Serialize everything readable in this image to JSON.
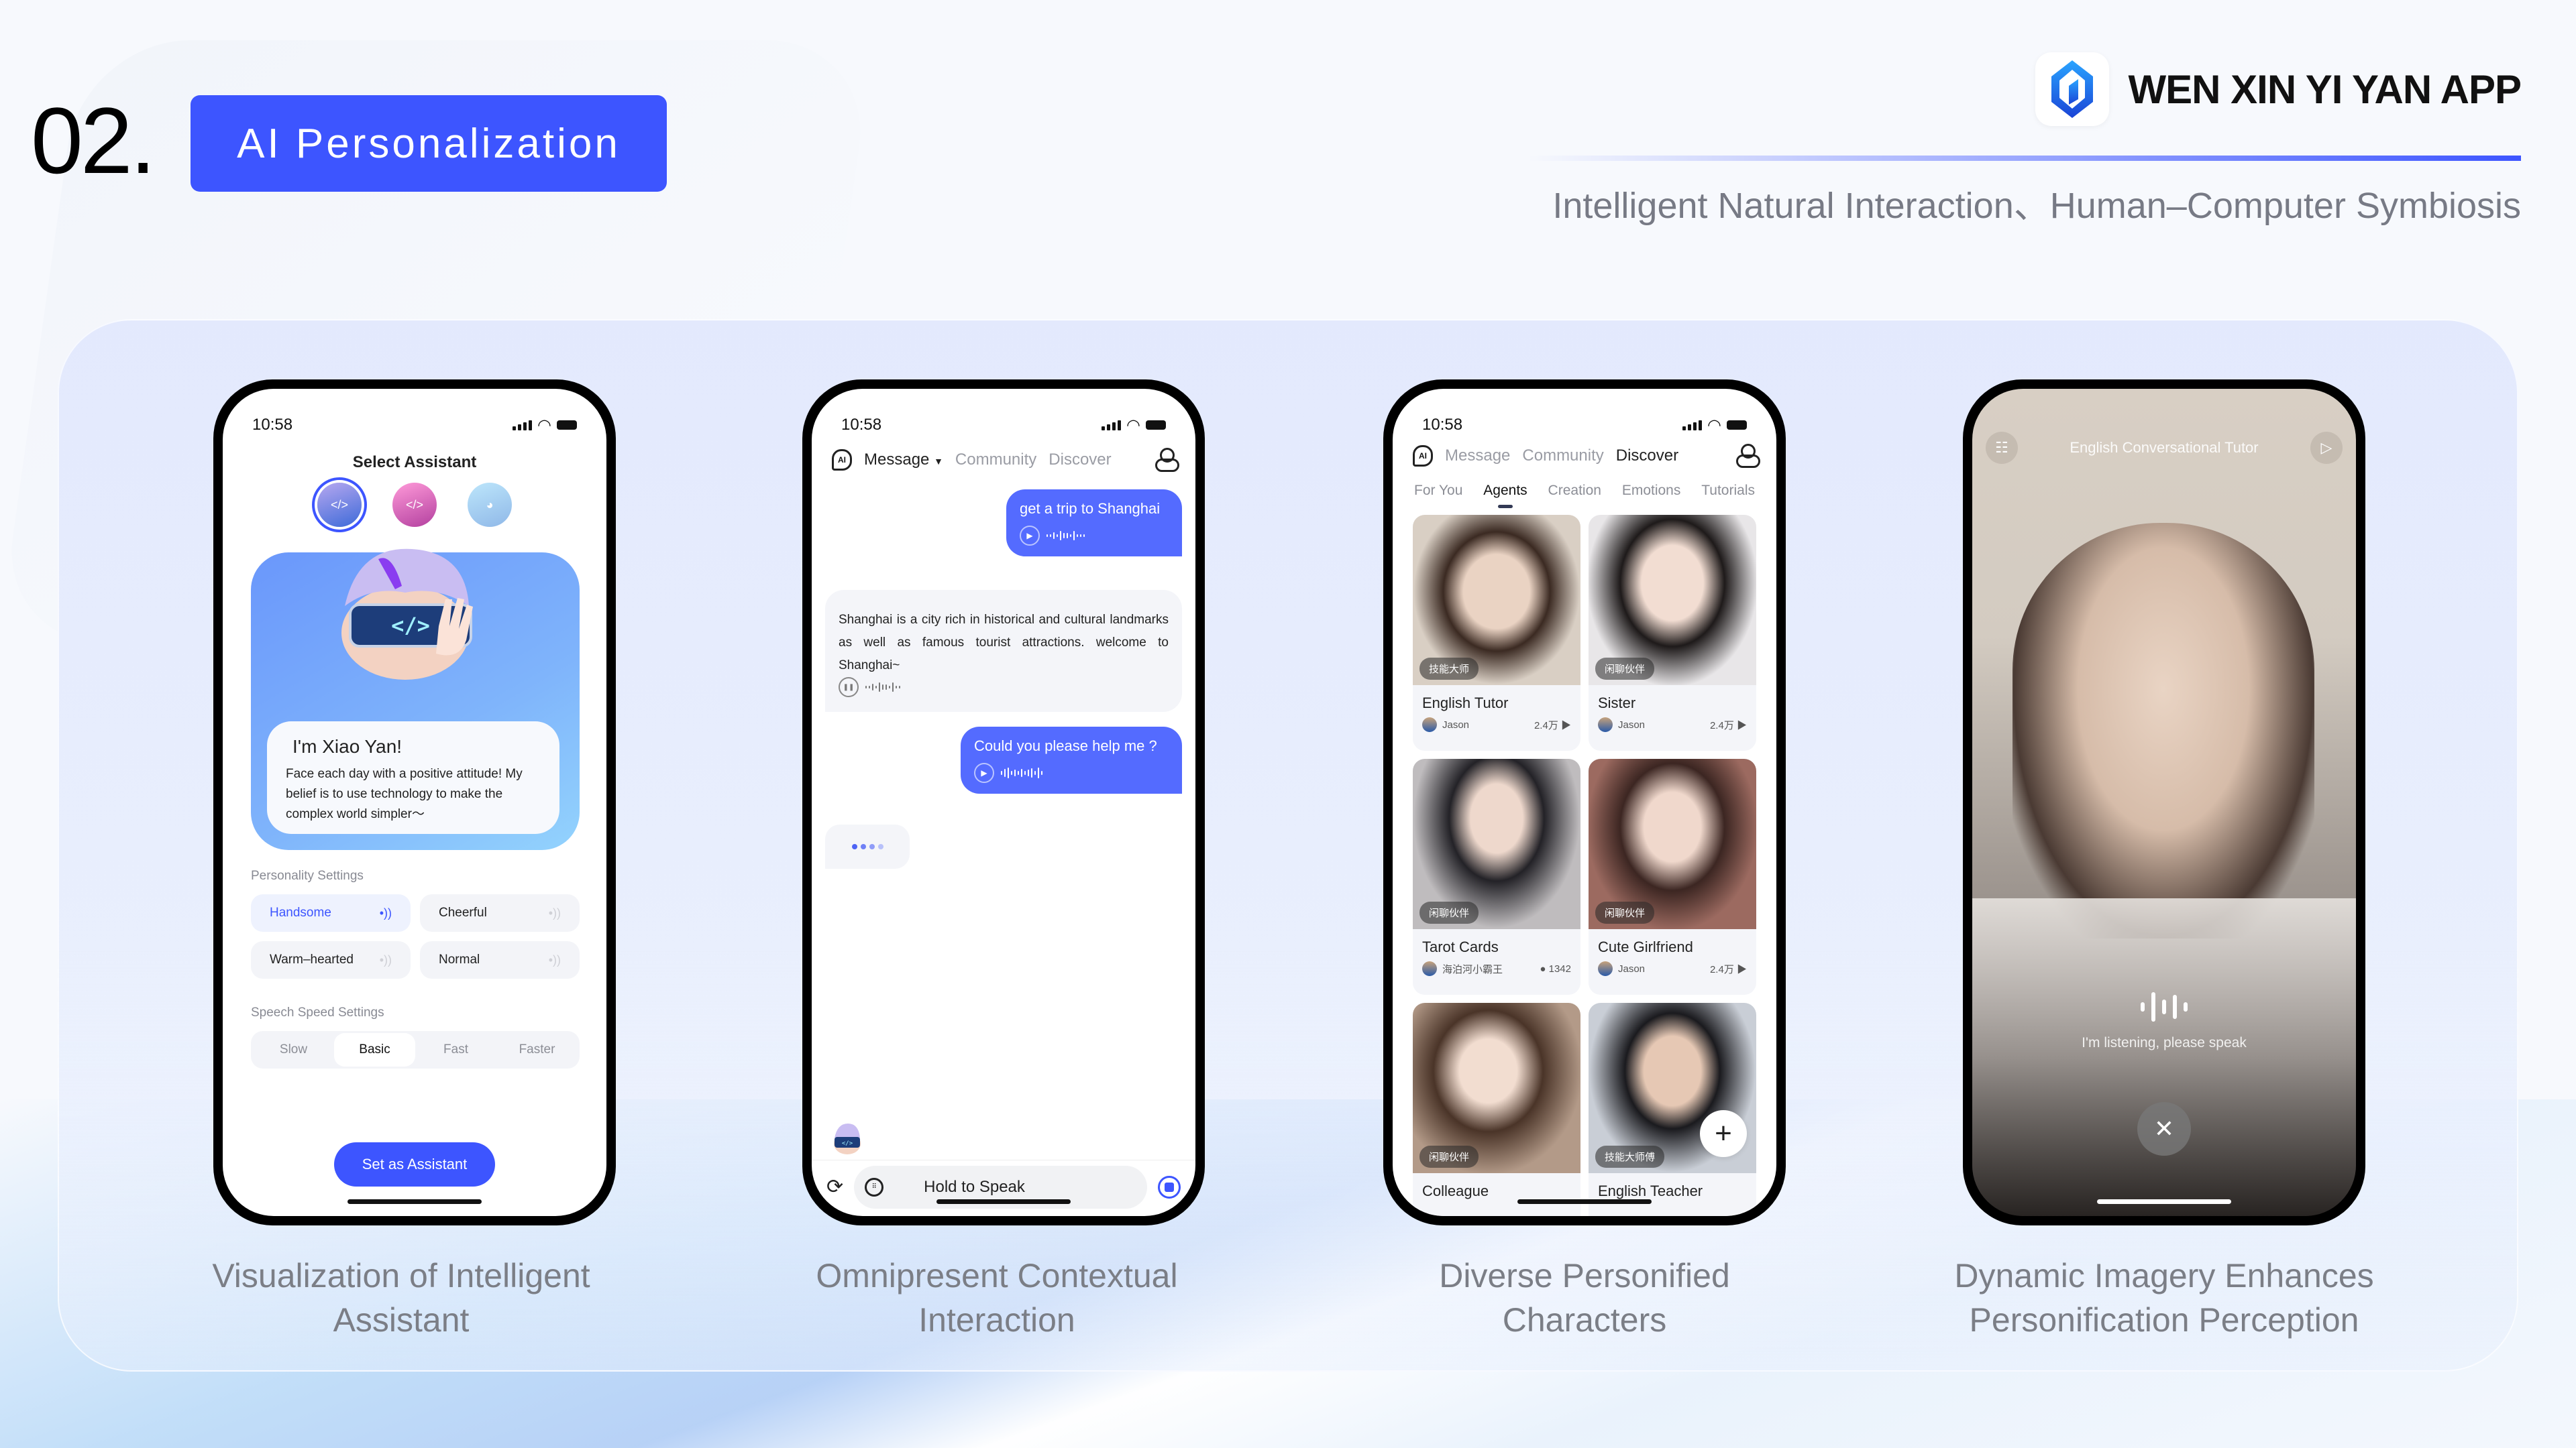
{
  "header": {
    "section_number": "02.",
    "section_title": "AI Personalization",
    "brand_name": "WEN XIN YI YAN APP",
    "tagline": "Intelligent Natural Interaction、Human–Computer Symbiosis",
    "accent_color": "#3d55ff"
  },
  "captions": [
    {
      "line1": "Visualization of Intelligent",
      "line2": "Assistant"
    },
    {
      "line1": "Omnipresent Contextual",
      "line2": "Interaction"
    },
    {
      "line1": "Diverse Personified",
      "line2": "Characters"
    },
    {
      "line1": "Dynamic Imagery Enhances",
      "line2": "Personification Perception"
    }
  ],
  "status_time": "10:58",
  "phone1": {
    "title": "Select Assistant",
    "avatars": [
      "robot-boy-avatar",
      "pink-girl-avatar",
      "anime-boy-avatar"
    ],
    "greeting": "I'm Xiao Yan!",
    "intro": "Face each day with a positive attitude! My belief is to use technology to make the complex world simpler～",
    "personality_label": "Personality Settings",
    "personalities": [
      {
        "label": "Handsome",
        "selected": true
      },
      {
        "label": "Cheerful",
        "selected": false
      },
      {
        "label": "Warm–hearted",
        "selected": false
      },
      {
        "label": "Normal",
        "selected": false
      }
    ],
    "speed_label": "Speech Speed Settings",
    "speeds": [
      "Slow",
      "Basic",
      "Fast",
      "Faster"
    ],
    "selected_speed": "Basic",
    "cta": "Set as Assistant"
  },
  "phone2": {
    "nav": {
      "logo": "AI",
      "tabs": [
        "Message",
        "Community",
        "Discover"
      ],
      "active": "Message"
    },
    "messages": [
      {
        "from": "user",
        "text": "get a trip to Shanghai"
      },
      {
        "from": "ai",
        "text": "Shanghai is a city rich in historical and cultural landmarks as well as famous tourist attractions. welcome to Shanghai~"
      },
      {
        "from": "user",
        "text": "Could you please help me ?"
      }
    ],
    "input_placeholder": "Hold to Speak"
  },
  "phone3": {
    "nav": {
      "logo": "AI",
      "tabs": [
        "Message",
        "Community",
        "Discover"
      ],
      "active": "Discover"
    },
    "subtabs": [
      "For You",
      "Agents",
      "Creation",
      "Emotions",
      "Tutorials"
    ],
    "active_subtab": "Agents",
    "cards": [
      {
        "name": "English Tutor",
        "tag": "技能大师",
        "author": "Jason",
        "stat": "2.4万 ▶"
      },
      {
        "name": "Sister",
        "tag": "闲聊伙伴",
        "author": "Jason",
        "stat": "2.4万 ▶"
      },
      {
        "name": "Tarot Cards",
        "tag": "闲聊伙伴",
        "author": "海泊河小霸王",
        "stat": "● 1342"
      },
      {
        "name": "Cute Girlfriend",
        "tag": "闲聊伙伴",
        "author": "Jason",
        "stat": "2.4万 ▶"
      },
      {
        "name": "Colleague",
        "tag": "闲聊伙伴",
        "author": "",
        "stat": ""
      },
      {
        "name": "English Teacher",
        "tag": "技能大师傅",
        "author": "",
        "stat": ""
      }
    ],
    "fab": "+"
  },
  "phone4": {
    "title": "English Conversational Tutor",
    "listening": "I'm listening, please speak",
    "close": "✕"
  }
}
